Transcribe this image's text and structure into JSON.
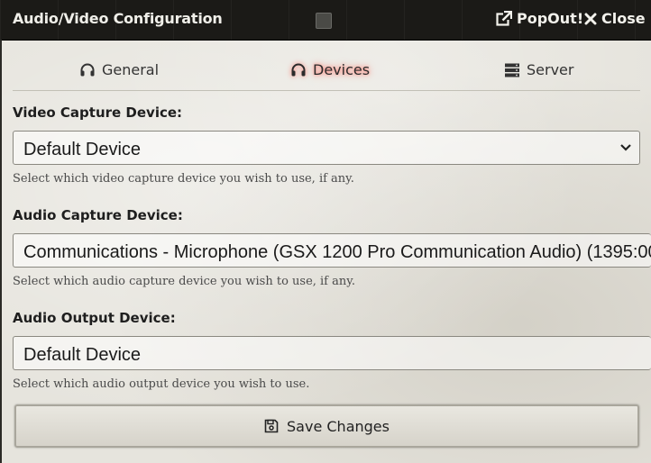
{
  "window": {
    "title": "Audio/Video Configuration",
    "popout_label": "PopOut!",
    "close_label": "Close"
  },
  "tabs": [
    {
      "label": "General",
      "icon": "headset-icon",
      "active": false
    },
    {
      "label": "Devices",
      "icon": "headset-icon",
      "active": true
    },
    {
      "label": "Server",
      "icon": "server-icon",
      "active": false
    }
  ],
  "fields": {
    "video": {
      "label": "Video Capture Device:",
      "value": "Default Device",
      "hint": "Select which video capture device you wish to use, if any."
    },
    "audio_in": {
      "label": "Audio Capture Device:",
      "value": "Communications - Microphone (GSX 1200 Pro Communication Audio) (1395:00",
      "hint": "Select which audio capture device you wish to use, if any."
    },
    "audio_out": {
      "label": "Audio Output Device:",
      "value": "Default Device",
      "hint": "Select which audio output device you wish to use."
    }
  },
  "save_label": "Save Changes",
  "colors": {
    "titlebar": "#1b1a17",
    "active_tab_glow": "#ff6f63",
    "panel": "#e6e4dd"
  }
}
